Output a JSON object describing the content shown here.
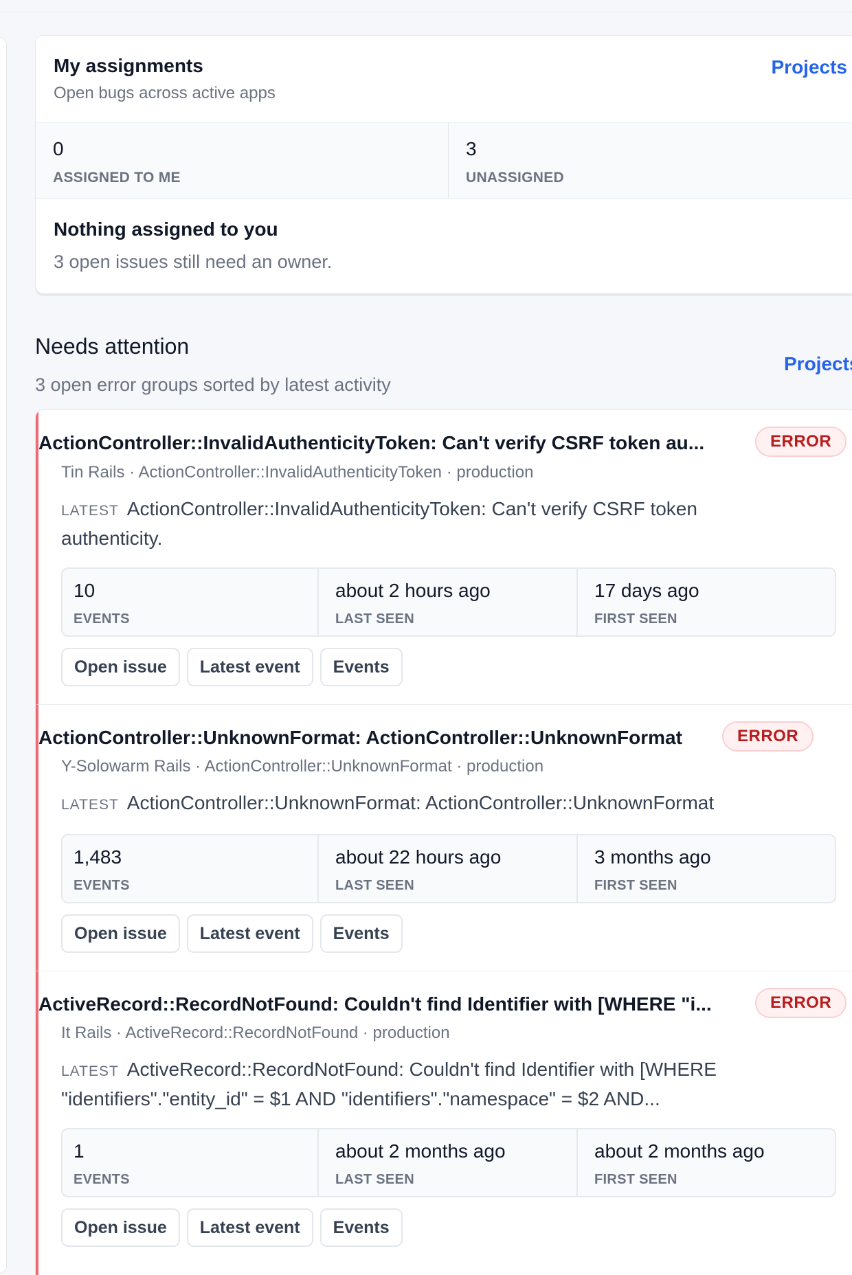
{
  "assignments": {
    "title": "My assignments",
    "subtitle": "Open bugs across active apps",
    "link_label": "Projects",
    "stats": [
      {
        "value": "0",
        "label": "ASSIGNED TO ME"
      },
      {
        "value": "3",
        "label": "UNASSIGNED"
      }
    ],
    "empty_title": "Nothing assigned to you",
    "empty_text": "3 open issues still need an owner."
  },
  "needs_attention": {
    "title": "Needs attention",
    "subtitle": "3 open error groups sorted by latest activity",
    "link_label": "Projects"
  },
  "issues": [
    {
      "title": "ActionController::InvalidAuthenticityToken: Can't verify CSRF token au...",
      "badge": "ERROR",
      "meta": "Tin Rails · ActionController::InvalidAuthenticityToken · production",
      "latest_label": "LATEST",
      "latest_text": "ActionController::InvalidAuthenticityToken: Can't verify CSRF token authenticity.",
      "metrics": [
        {
          "value": "10",
          "label": "EVENTS"
        },
        {
          "value": "about 2 hours ago",
          "label": "LAST SEEN"
        },
        {
          "value": "17 days ago",
          "label": "FIRST SEEN"
        }
      ],
      "actions": [
        "Open issue",
        "Latest event",
        "Events"
      ]
    },
    {
      "title": "ActionController::UnknownFormat: ActionController::UnknownFormat",
      "badge": "ERROR",
      "meta": "Y-Solowarm Rails · ActionController::UnknownFormat · production",
      "latest_label": "LATEST",
      "latest_text": "ActionController::UnknownFormat: ActionController::UnknownFormat",
      "metrics": [
        {
          "value": "1,483",
          "label": "EVENTS"
        },
        {
          "value": "about 22 hours ago",
          "label": "LAST SEEN"
        },
        {
          "value": "3 months ago",
          "label": "FIRST SEEN"
        }
      ],
      "actions": [
        "Open issue",
        "Latest event",
        "Events"
      ]
    },
    {
      "title": "ActiveRecord::RecordNotFound: Couldn't find Identifier with [WHERE \"i...",
      "badge": "ERROR",
      "meta": "It Rails · ActiveRecord::RecordNotFound · production",
      "latest_label": "LATEST",
      "latest_text": "ActiveRecord::RecordNotFound: Couldn't find Identifier with [WHERE \"identifiers\".\"entity_id\" = $1 AND \"identifiers\".\"namespace\" = $2 AND...",
      "metrics": [
        {
          "value": "1",
          "label": "EVENTS"
        },
        {
          "value": "about 2 months ago",
          "label": "LAST SEEN"
        },
        {
          "value": "about 2 months ago",
          "label": "FIRST SEEN"
        }
      ],
      "actions": [
        "Open issue",
        "Latest event",
        "Events"
      ]
    }
  ]
}
